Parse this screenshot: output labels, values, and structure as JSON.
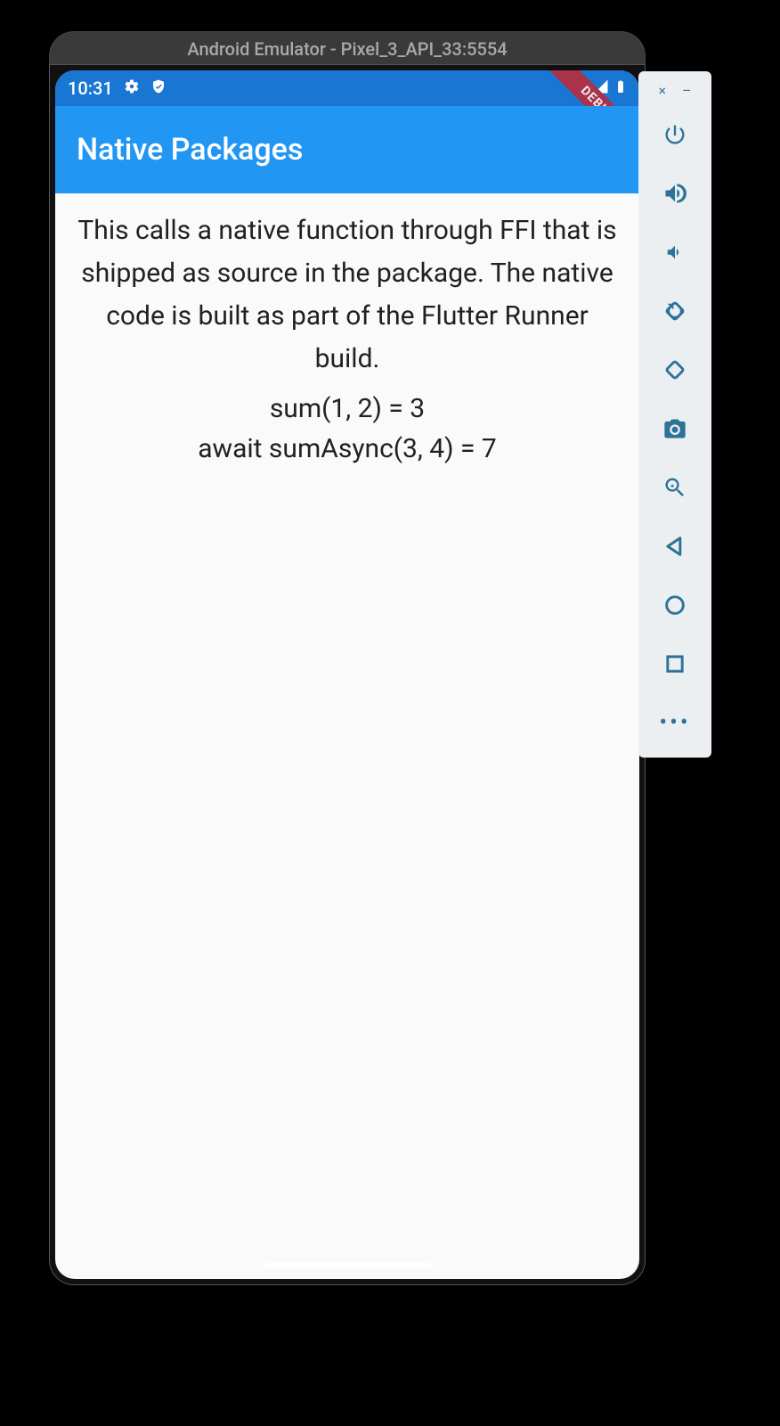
{
  "emulator": {
    "title": "Android Emulator - Pixel_3_API_33:5554"
  },
  "statusbar": {
    "time": "10:31"
  },
  "appbar": {
    "title": "Native Packages",
    "debug_label": "DEBUG"
  },
  "body": {
    "description": "This calls a native function through FFI that is shipped as source in the package. The native code is built as part of the Flutter Runner build.",
    "sum_line": "sum(1, 2) = 3",
    "async_line": "await sumAsync(3, 4) = 7"
  },
  "toolbar": {
    "close": "×",
    "minimize": "–",
    "more": "•••"
  }
}
